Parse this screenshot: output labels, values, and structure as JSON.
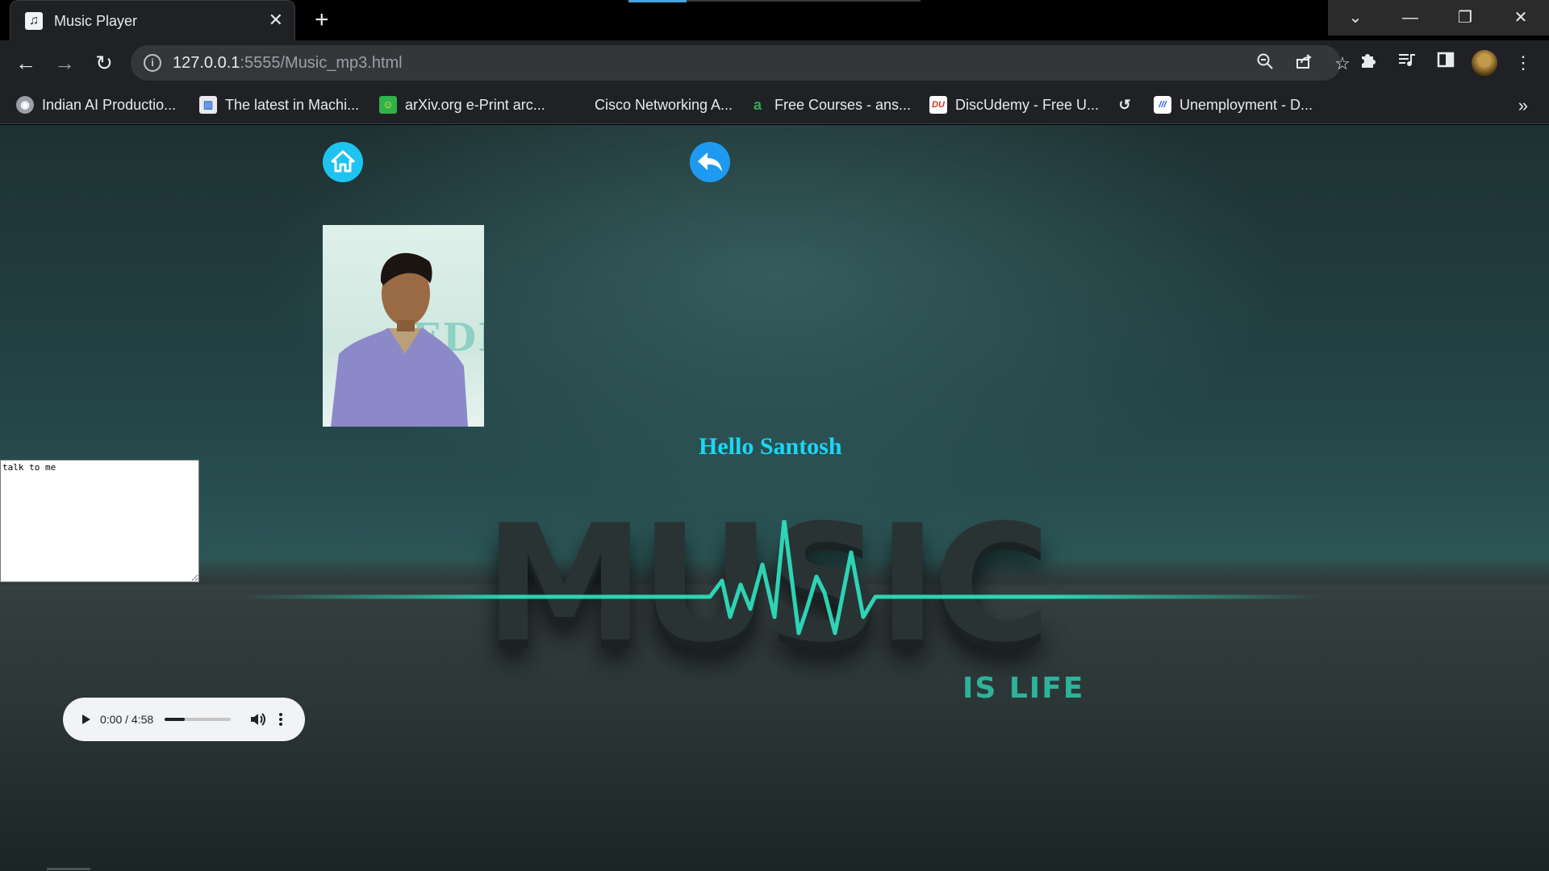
{
  "browser": {
    "tab": {
      "title": "Music Player",
      "close_glyph": "✕",
      "favicon": "music-note-icon"
    },
    "new_tab_glyph": "+",
    "window_controls": {
      "dropdown": "⌄",
      "minimize": "—",
      "restore": "❐",
      "close": "✕"
    },
    "toolbar": {
      "back": "←",
      "forward": "→",
      "reload": "↻",
      "url_host": "127.0.0.1",
      "url_path": ":5555/Music_mp3.html",
      "info_glyph": "i"
    },
    "bookmarks": [
      {
        "label": "Indian AI Productio...",
        "icon": "globe-icon",
        "color": "#9aa0a6"
      },
      {
        "label": "The latest in Machi...",
        "icon": "paper-icon",
        "color": "#2f6fd6"
      },
      {
        "label": "arXiv.org e-Print arc...",
        "icon": "smiley-icon",
        "color": "#2fb34a"
      },
      {
        "label": "Cisco Networking A...",
        "icon": "cisco-icon",
        "color": "#202124"
      },
      {
        "label": "Free Courses - ans...",
        "icon": "letter-a-icon",
        "color": "#34a853"
      },
      {
        "label": "DiscUdemy - Free U...",
        "icon": "du-icon",
        "color": "#d93025"
      },
      {
        "label": "Unemployment - D...",
        "icon": "bank-icon",
        "color": "#1a56db"
      }
    ],
    "bookmarks_more": "»",
    "accent": "#4aa3df"
  },
  "page": {
    "greeting": "Hello Santosh",
    "photo_text": "EDI",
    "talk_box_text": "talk to me",
    "background_heading": "MUSIC",
    "background_tagline": "IS LIFE",
    "audio": {
      "time": "0:00 / 4:58",
      "progress": 0.3
    },
    "colors": {
      "greeting": "#1ed6f2",
      "pulse": "#2ee6c2",
      "home_button": "#1ec3f0",
      "back_button": "#1e9bf0"
    }
  }
}
